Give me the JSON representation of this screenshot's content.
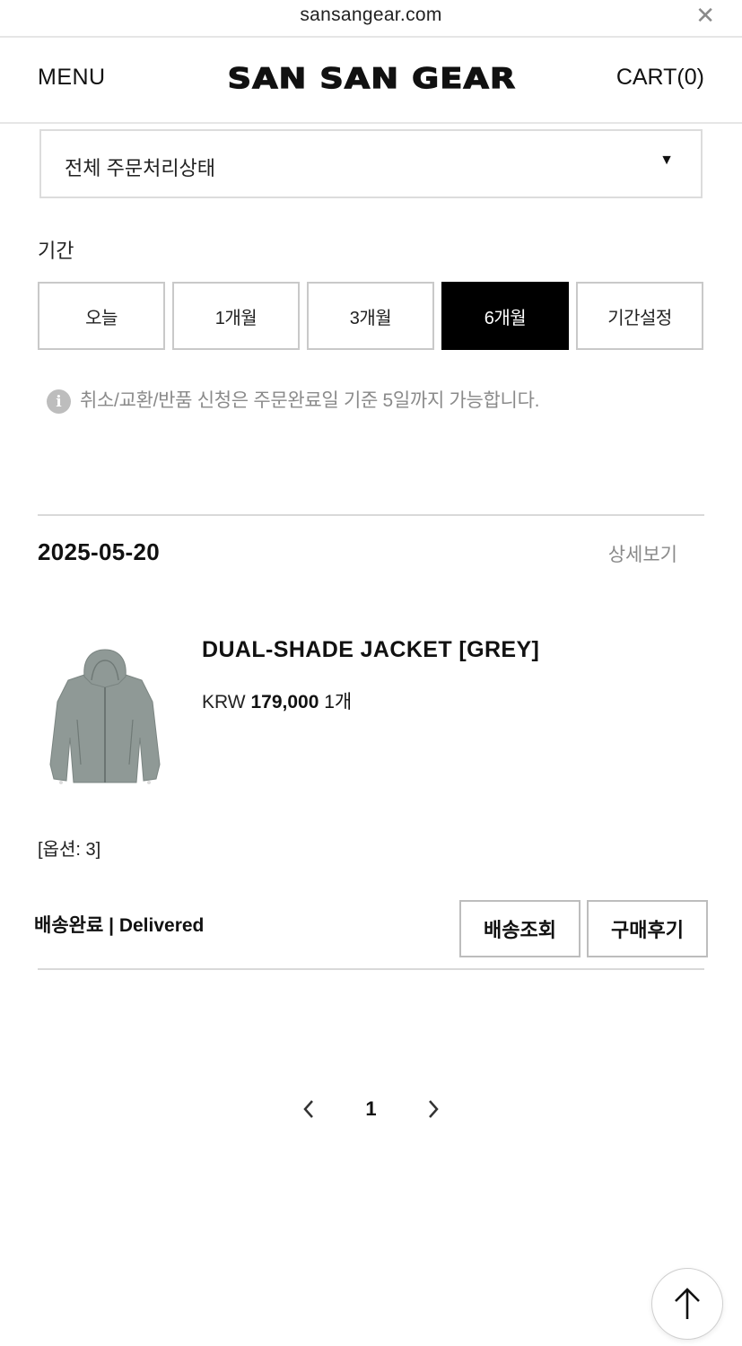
{
  "browser": {
    "url": "sansangear.com",
    "close_glyph": "✕"
  },
  "header": {
    "menu_label": "MENU",
    "logo_text": "SAN SAN GEAR",
    "cart_label": "CART(0)"
  },
  "filters": {
    "status_select": "전체 주문처리상태",
    "period_label": "기간",
    "periods": [
      "오늘",
      "1개월",
      "3개월",
      "6개월",
      "기간설정"
    ],
    "active_period": "6개월",
    "notice": "취소/교환/반품 신청은 주문완료일 기준 5일까지 가능합니다."
  },
  "order": {
    "date": "2025-05-20",
    "detail_link": "상세보기",
    "product": {
      "name": "DUAL-SHADE JACKET [GREY]",
      "currency": "KRW",
      "price": "179,000",
      "quantity": "1개",
      "option": "[옵션: 3]",
      "image_color": "#8f9996"
    },
    "status": "배송완료 | Delivered",
    "actions": [
      "배송조회",
      "구매후기"
    ]
  },
  "pagination": {
    "current_page": "1"
  },
  "colors": {
    "active_bg": "#000000",
    "border": "#c9c9c9",
    "muted_text": "#8a8a8a"
  }
}
